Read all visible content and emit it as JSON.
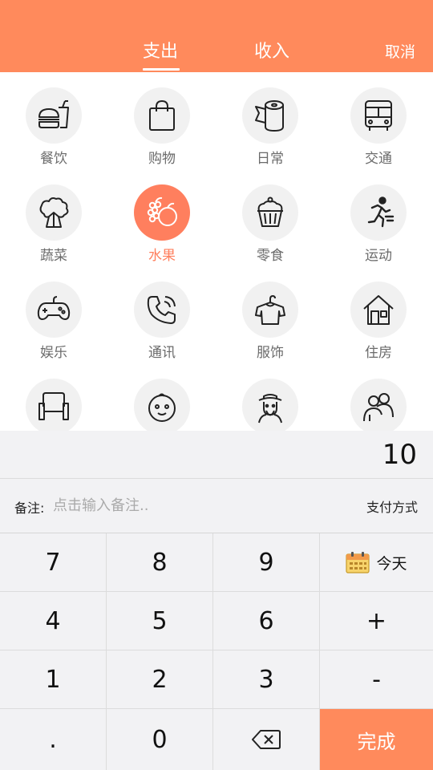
{
  "header": {
    "tabs": [
      {
        "label": "支出",
        "active": true
      },
      {
        "label": "收入",
        "active": false
      }
    ],
    "cancel_label": "取消",
    "background_color": "#FF8A5C"
  },
  "categories": [
    {
      "label": "餐饮",
      "icon": "fastfood-icon"
    },
    {
      "label": "购物",
      "icon": "shopping-bag-icon"
    },
    {
      "label": "日常",
      "icon": "toilet-paper-icon"
    },
    {
      "label": "交通",
      "icon": "bus-icon"
    },
    {
      "label": "蔬菜",
      "icon": "vegetable-icon"
    },
    {
      "label": "水果",
      "icon": "fruit-icon",
      "selected": true
    },
    {
      "label": "零食",
      "icon": "cupcake-icon"
    },
    {
      "label": "运动",
      "icon": "running-icon"
    },
    {
      "label": "娱乐",
      "icon": "gamepad-icon"
    },
    {
      "label": "通讯",
      "icon": "phone-icon"
    },
    {
      "label": "服饰",
      "icon": "clothes-icon"
    },
    {
      "label": "住房",
      "icon": "house-icon"
    },
    {
      "label": "",
      "icon": "sofa-icon"
    },
    {
      "label": "",
      "icon": "baby-icon"
    },
    {
      "label": "",
      "icon": "elder-icon"
    },
    {
      "label": "",
      "icon": "people-icon"
    }
  ],
  "amount": "10",
  "remark": {
    "label": "备注:",
    "placeholder": "点击输入备注..",
    "value": ""
  },
  "payment_method_label": "支付方式",
  "keypad": {
    "keys": [
      "7",
      "8",
      "9",
      "4",
      "5",
      "6",
      "1",
      "2",
      "3",
      ".",
      "0"
    ],
    "today_label": "今天",
    "plus_label": "+",
    "minus_label": "-",
    "done_label": "完成"
  },
  "colors": {
    "accent": "#FF7F5E",
    "panel": "#F2F2F4"
  }
}
